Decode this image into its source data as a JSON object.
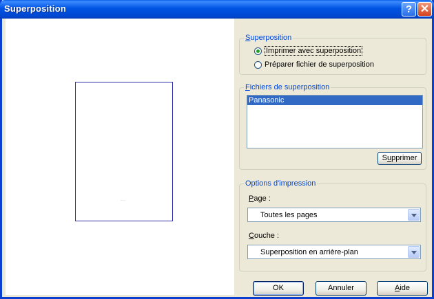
{
  "window": {
    "title": "Superposition",
    "help_glyph": "?",
    "close_glyph": "✕"
  },
  "preview": {
    "page_mark": "......"
  },
  "superposition": {
    "legend_key": "S",
    "legend_rest": "uperposition",
    "options": [
      {
        "label": "Imprimer avec superposition",
        "selected": true
      },
      {
        "label": "Préparer fichier de superposition",
        "selected": false
      }
    ]
  },
  "fichiers": {
    "legend_key": "F",
    "legend_rest": "ichiers de superposition",
    "items": [
      "Panasonic"
    ],
    "delete_pre": "S",
    "delete_key": "u",
    "delete_post": "pprimer"
  },
  "options_impression": {
    "legend": "Options d'impression",
    "page_key": "P",
    "page_rest": "age :",
    "page_value": "Toutes les pages",
    "couche_key": "C",
    "couche_rest": "ouche :",
    "couche_value": "Superposition en arrière-plan"
  },
  "buttons": {
    "ok": "OK",
    "cancel": "Annuler",
    "help_key": "A",
    "help_rest": "ide"
  },
  "colors": {
    "title_bar": "#0054e3",
    "legend_text": "#0046d5",
    "selection": "#316ac5"
  }
}
